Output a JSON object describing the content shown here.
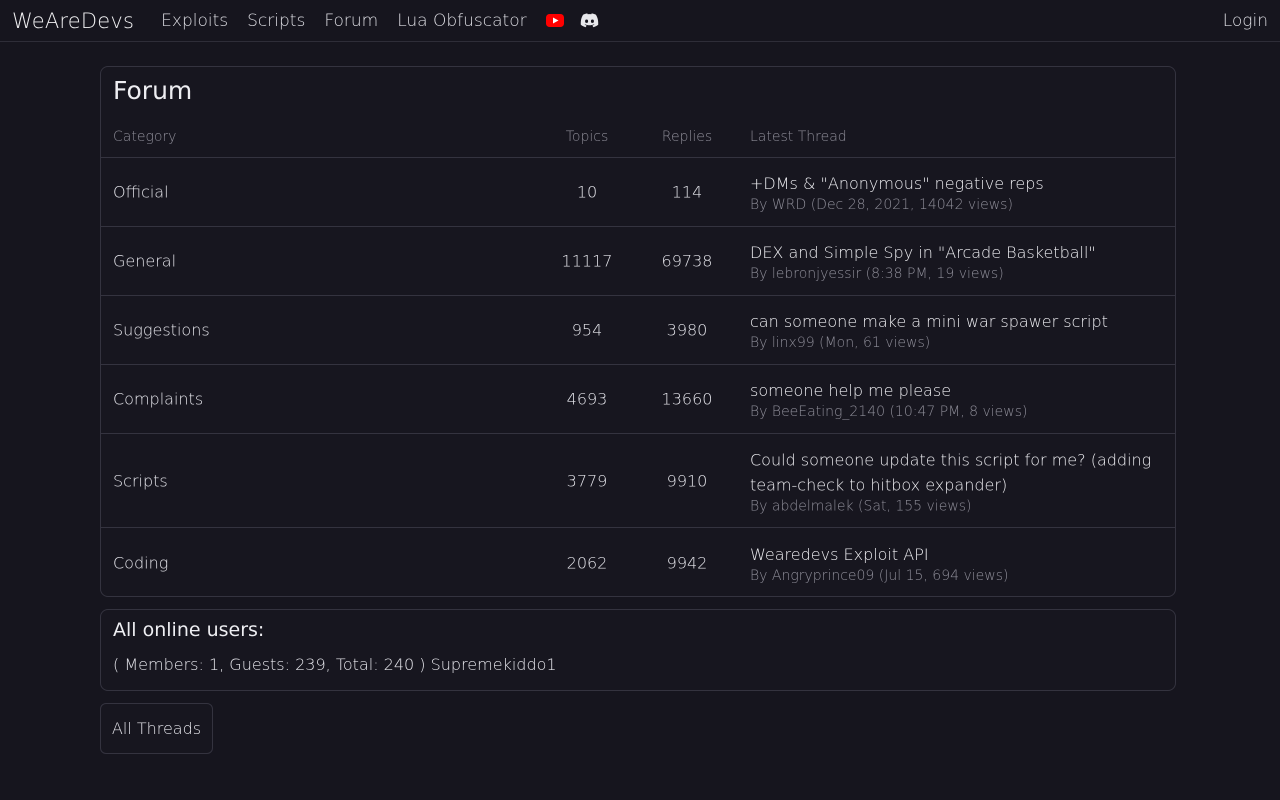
{
  "nav": {
    "brand": "WeAreDevs",
    "links": [
      "Exploits",
      "Scripts",
      "Forum",
      "Lua Obfuscator"
    ],
    "icons": [
      "youtube-icon",
      "discord-icon"
    ],
    "login": "Login"
  },
  "forum": {
    "title": "Forum",
    "headers": {
      "category": "Category",
      "topics": "Topics",
      "replies": "Replies",
      "latest": "Latest Thread"
    },
    "rows": [
      {
        "category": "Official",
        "topics": "10",
        "replies": "114",
        "latest_title": "+DMs & \"Anonymous\" negative reps",
        "latest_meta": "By WRD (Dec 28, 2021, 14042 views)"
      },
      {
        "category": "General",
        "topics": "11117",
        "replies": "69738",
        "latest_title": "DEX and Simple Spy in \"Arcade Basketball\"",
        "latest_meta": "By lebronjyessir (8:38 PM, 19 views)"
      },
      {
        "category": "Suggestions",
        "topics": "954",
        "replies": "3980",
        "latest_title": "can someone make a mini war spawer script",
        "latest_meta": "By linx99 (Mon, 61 views)"
      },
      {
        "category": "Complaints",
        "topics": "4693",
        "replies": "13660",
        "latest_title": "someone help me please",
        "latest_meta": "By BeeEating_2140 (10:47 PM, 8 views)"
      },
      {
        "category": "Scripts",
        "topics": "3779",
        "replies": "9910",
        "latest_title": "Could someone update this script for me? (adding team-check to hitbox expander)",
        "latest_meta": "By abdelmalek (Sat, 155 views)"
      },
      {
        "category": "Coding",
        "topics": "2062",
        "replies": "9942",
        "latest_title": "Wearedevs Exploit API",
        "latest_meta": "By Angryprince09 (Jul 15, 694 views)"
      }
    ]
  },
  "online": {
    "title": "All online users:",
    "text": "( Members: 1, Guests: 239, Total: 240 ) Supremekiddo1"
  },
  "buttons": {
    "all_threads": "All Threads"
  },
  "colors": {
    "background": "#16151e",
    "border": "#34333f",
    "youtube": "#ff0000",
    "muted_text": "#8e8d98"
  }
}
